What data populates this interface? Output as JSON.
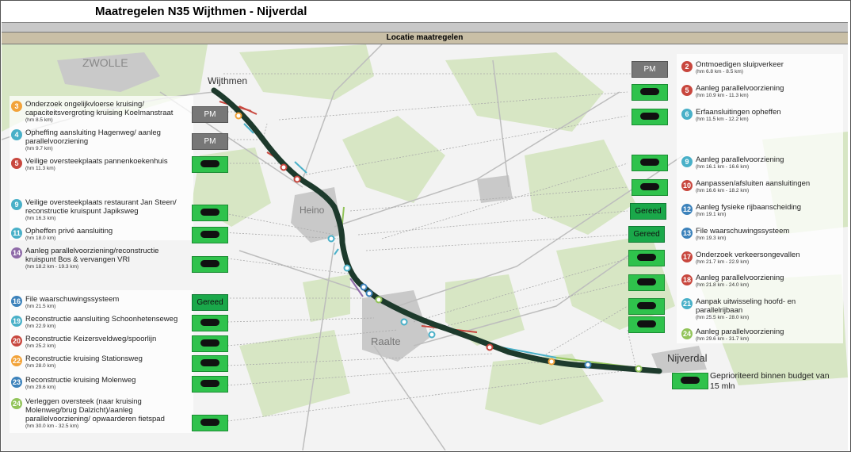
{
  "title": "Maatregelen N35 Wijthmen - Nijverdal",
  "section_header": "Locatie maatregelen",
  "places": {
    "zwolle": "ZWOLLE",
    "wijthmen": "Wijthmen",
    "heino": "Heino",
    "raalte": "Raalte",
    "nijverdal": "Nijverdal"
  },
  "left_items": [
    {
      "num": "3",
      "color": "orange",
      "label": "Onderzoek ongelijkvloerse kruising/ capaciteitsvergroting kruising Koelmanstraat",
      "hm": "(hm 8.5 km)",
      "status": "PM"
    },
    {
      "num": "4",
      "color": "teal",
      "label": "Opheffing aansluiting Hagenweg/ aanleg parallelvoorziening",
      "hm": "(hm 9.7 km)",
      "status": "PM"
    },
    {
      "num": "5",
      "color": "red",
      "label": "Veilige oversteekplaats pannenkoekenhuis",
      "hm": "(hm 11.3 km)",
      "status": "budget"
    },
    {
      "num": "9",
      "color": "teal",
      "label": "Veilige oversteekplaats restaurant Jan Steen/ reconstructie kruispunt Japiksweg",
      "hm": "(hm 16.3 km)",
      "status": "budget"
    },
    {
      "num": "11",
      "color": "teal",
      "label": "Opheffen privé aansluiting",
      "hm": "(hm 18.0 km)",
      "status": "budget"
    },
    {
      "num": "14",
      "color": "purple",
      "label": "Aanleg parallelvoorziening/reconstructie kruispunt Bos & vervangen VRI",
      "hm": "(hm 18.2 km - 19.3 km)",
      "status": "budget"
    },
    {
      "num": "16",
      "color": "blue",
      "label": "File waarschuwingssysteem",
      "hm": "(hm 21.5 km)",
      "status": "Gereed"
    },
    {
      "num": "19",
      "color": "teal",
      "label": "Reconstructie aansluiting Schoonhetenseweg",
      "hm": "(hm 22.9 km)",
      "status": "budget"
    },
    {
      "num": "20",
      "color": "red",
      "label": "Reconstructie Keizersveldweg/spoorlijn",
      "hm": "(hm 25.2 km)",
      "status": "budget"
    },
    {
      "num": "22",
      "color": "orange",
      "label": "Reconstructie kruising Stationsweg",
      "hm": "(hm 28.0 km)",
      "status": "budget"
    },
    {
      "num": "23",
      "color": "blue",
      "label": "Reconstructie kruising Molenweg",
      "hm": "(hm 29.6 km)",
      "status": "budget"
    },
    {
      "num": "24",
      "color": "green",
      "label": "Verleggen oversteek (naar kruising Molenweg/brug Dalzicht)/aanleg parallelvoorziening/ opwaarderen fietspad",
      "hm": "(hm 30.0 km - 32.5 km)",
      "status": "budget"
    }
  ],
  "right_items": [
    {
      "num": "2",
      "color": "red",
      "label": "Ontmoedigen sluipverkeer",
      "hm": "(hm 6.8 km - 8.5 km)",
      "status": "PM"
    },
    {
      "num": "5",
      "color": "red",
      "label": "Aanleg parallelvoorziening",
      "hm": "(hm 10.9 km - 11.3 km)",
      "status": "budget"
    },
    {
      "num": "6",
      "color": "teal",
      "label": "Erfaansluitingen opheffen",
      "hm": "(hm 11.5 km - 12.2 km)",
      "status": "budget"
    },
    {
      "num": "9",
      "color": "teal",
      "label": "Aanleg parallelvoorziening",
      "hm": "(hm 16.1 km - 16.6 km)",
      "status": "budget"
    },
    {
      "num": "10",
      "color": "red",
      "label": "Aanpassen/afsluiten aansluitingen",
      "hm": "(hm 16.6 km - 18.2 km)",
      "status": "budget"
    },
    {
      "num": "12",
      "color": "blue",
      "label": "Aanleg fysieke rijbaanscheiding",
      "hm": "(hm 19.1 km)",
      "status": "Gereed"
    },
    {
      "num": "13",
      "color": "blue",
      "label": "File waarschuwingssysteem",
      "hm": "(hm 19.3 km)",
      "status": "Gereed"
    },
    {
      "num": "17",
      "color": "red",
      "label": "Onderzoek verkeersongevallen",
      "hm": "(hm 21.7 km - 22.9 km)",
      "status": "budget"
    },
    {
      "num": "18",
      "color": "red",
      "label": "Aanleg parallelvoorziening",
      "hm": "(hm 21.8 km - 24.0 km)",
      "status": "budget"
    },
    {
      "num": "21",
      "color": "teal",
      "label": "Aanpak uitwisseling hoofd- en parallelrijbaan",
      "hm": "(hm 25.5 km - 28.0 km)",
      "status": "budget"
    },
    {
      "num": "24",
      "color": "green",
      "label": "Aanleg parallelvoorziening",
      "hm": "(hm 29.6 km - 31.7 km)",
      "status": "budget"
    }
  ],
  "legend": {
    "text": "Geprioriteerd binnen budget van 15 mln"
  },
  "colors": {
    "orange": "#f2a33a",
    "teal": "#49b0c8",
    "red": "#c8473e",
    "purple": "#8e6aa8",
    "blue": "#3c82bb",
    "green": "#92c45a",
    "road": "#1d3a2c",
    "status_green": "#2fc24c"
  }
}
